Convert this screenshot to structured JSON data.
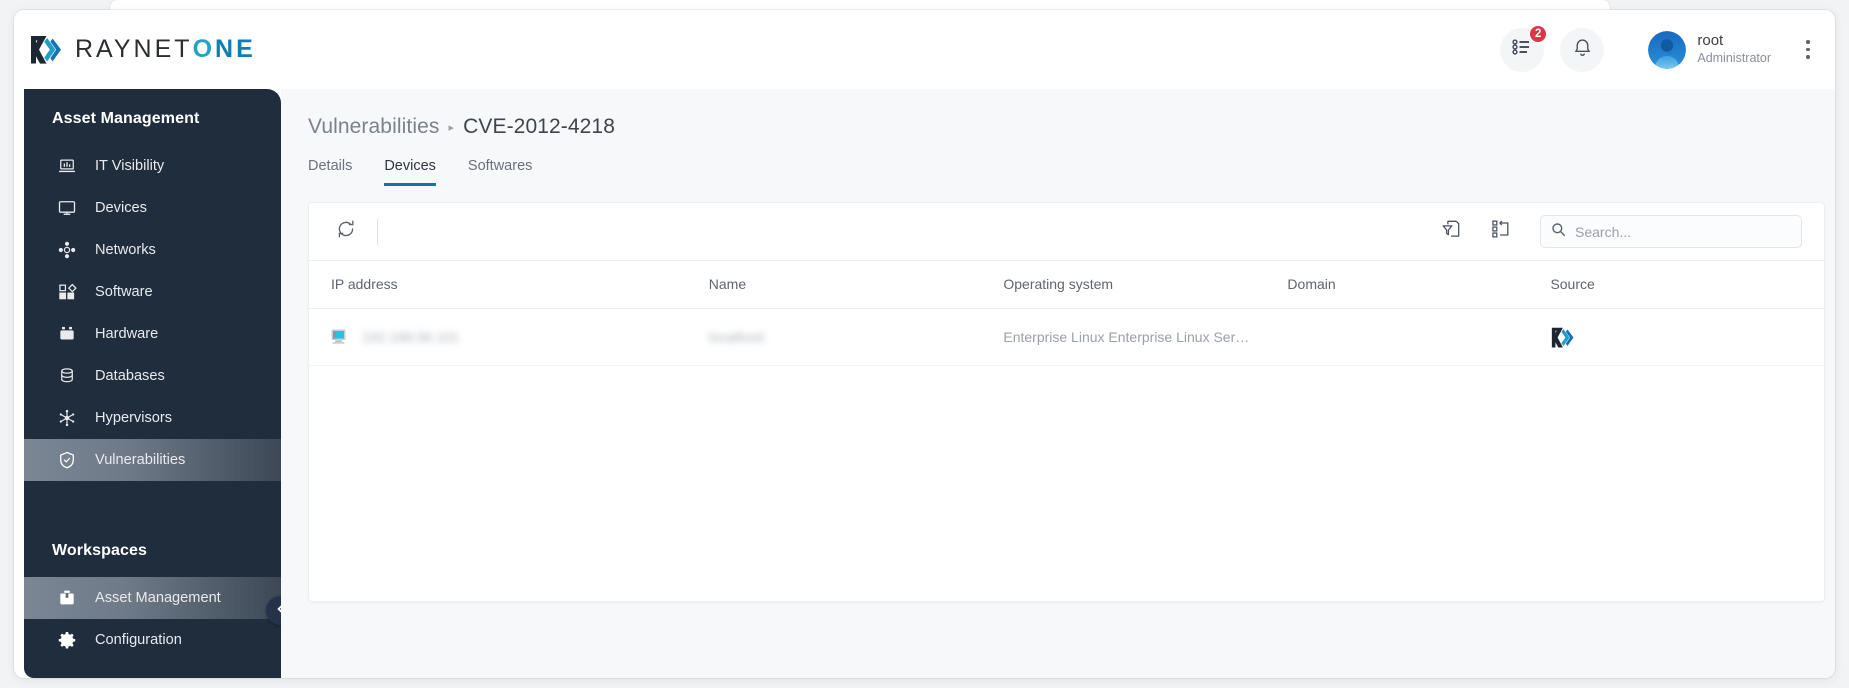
{
  "brand": {
    "name_dark": "RAYNET",
    "name_o": "O",
    "name_ne": "NE",
    "mark": "raynet-logo-mark"
  },
  "header": {
    "tasks_icon": "task-list-icon",
    "tasks_badge": "2",
    "notifications_icon": "bell-icon",
    "user_name": "root",
    "user_role": "Administrator",
    "avatar_icon": "user-avatar",
    "kebab_icon": "vertical-dots-icon"
  },
  "sidebar": {
    "section_title": "Asset Management",
    "items": [
      {
        "label": "IT Visibility",
        "icon": "laptop-chart-icon",
        "active": false
      },
      {
        "label": "Devices",
        "icon": "monitor-icon",
        "active": false
      },
      {
        "label": "Networks",
        "icon": "network-nodes-icon",
        "active": false
      },
      {
        "label": "Software",
        "icon": "squares-diamond-icon",
        "active": false
      },
      {
        "label": "Hardware",
        "icon": "hardware-box-icon",
        "active": false
      },
      {
        "label": "Databases",
        "icon": "database-icon",
        "active": false
      },
      {
        "label": "Hypervisors",
        "icon": "snowflake-icon",
        "active": false
      },
      {
        "label": "Vulnerabilities",
        "icon": "shield-check-icon",
        "active": true
      }
    ],
    "workspaces_title": "Workspaces",
    "workspaces": [
      {
        "label": "Asset Management",
        "icon": "briefcase-icon",
        "active": true
      },
      {
        "label": "Configuration",
        "icon": "gear-icon",
        "active": false
      }
    ],
    "collapse_icon": "chevron-left-icon"
  },
  "main": {
    "breadcrumb": {
      "parent": "Vulnerabilities",
      "separator": "▸",
      "current": "CVE-2012-4218"
    },
    "tabs": [
      {
        "label": "Details",
        "active": false
      },
      {
        "label": "Devices",
        "active": true
      },
      {
        "label": "Softwares",
        "active": false
      }
    ],
    "toolbar": {
      "refresh_icon": "refresh-icon",
      "filter_icon": "filter-document-icon",
      "columns_icon": "column-settings-icon",
      "search_icon": "search-icon",
      "search_placeholder": "Search...",
      "search_value": ""
    },
    "table": {
      "columns": [
        "IP address",
        "Name",
        "Operating system",
        "Domain",
        "Source"
      ],
      "rows": [
        {
          "icon": "device-monitor-icon",
          "ip_address": "192.168.56.101",
          "name": "localhost",
          "operating_system": "Enterprise Linux Enterprise Linux Ser…",
          "domain": "",
          "source_icon": "raynet-logo-mark",
          "redacted": [
            "ip_address",
            "name"
          ]
        }
      ]
    }
  },
  "colors": {
    "sidebar_bg": "#1f2d3d",
    "accent_blue": "#1175a8",
    "accent_teal": "#23a3c4",
    "badge_red": "#dc3545",
    "page_bg": "#f7f8f9"
  }
}
